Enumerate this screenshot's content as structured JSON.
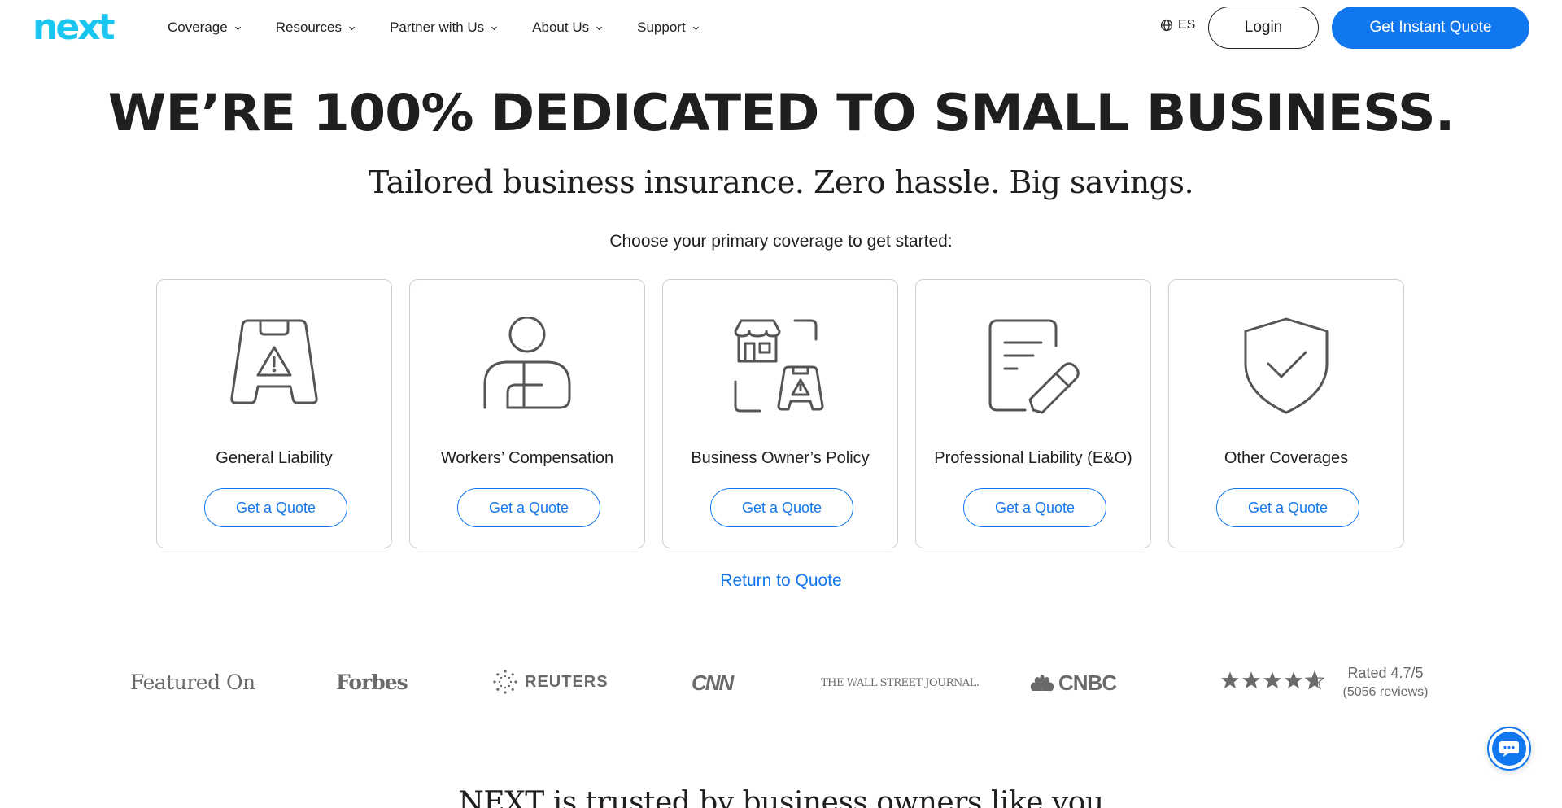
{
  "header": {
    "logo_text": "next",
    "nav": [
      {
        "label": "Coverage"
      },
      {
        "label": "Resources"
      },
      {
        "label": "Partner with Us"
      },
      {
        "label": "About Us"
      },
      {
        "label": "Support"
      }
    ],
    "language": "ES",
    "login_label": "Login",
    "quote_label": "Get Instant Quote"
  },
  "hero": {
    "title": "WE’RE 100% DEDICATED TO SMALL BUSINESS.",
    "subtitle": "Tailored business insurance. Zero hassle. Big savings.",
    "choose": "Choose your primary coverage to get started:"
  },
  "cards": [
    {
      "label": "General Liability",
      "button": "Get a Quote",
      "icon": "wet-floor-sign-icon"
    },
    {
      "label": "Workers’ Compensation",
      "button": "Get a Quote",
      "icon": "injured-worker-icon"
    },
    {
      "label": "Business Owner’s Policy",
      "button": "Get a Quote",
      "icon": "storefront-bundle-icon"
    },
    {
      "label": "Professional Liability (E&O)",
      "button": "Get a Quote",
      "icon": "document-pen-icon"
    },
    {
      "label": "Other Coverages",
      "button": "Get a Quote",
      "icon": "shield-check-icon"
    }
  ],
  "return_link": "Return to Quote",
  "featured": {
    "label": "Featured On",
    "outlets": [
      "Forbes",
      "REUTERS",
      "CNN",
      "THE WALL STREET JOURNAL.",
      "CNBC"
    ],
    "rating_text": "Rated 4.7/5",
    "reviews_text": "(5056 reviews)",
    "stars": 4.7
  },
  "trusted_heading": "NEXT is trusted by business owners like you",
  "colors": {
    "brand_cyan": "#18c6f0",
    "accent_blue": "#1177ee",
    "text": "#1f1f1f",
    "muted": "#6a6a6a"
  }
}
